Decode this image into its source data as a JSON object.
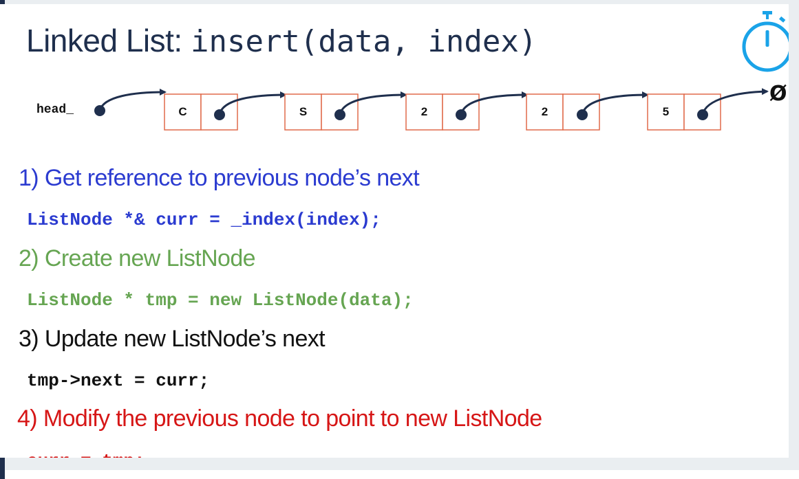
{
  "slide": {
    "title_text": "Linked List: ",
    "title_code": "insert(data, index)"
  },
  "diagram": {
    "head_label": "head_",
    "nodes": [
      "C",
      "S",
      "2",
      "2",
      "5"
    ],
    "null_symbol": "Ø",
    "node_border_color": "#e06a4a",
    "pointer_color": "#1f2f4d"
  },
  "timer": {
    "icon": "stopwatch-icon",
    "color": "#1aa3e8"
  },
  "steps": [
    {
      "label": "1) Get reference to previous node’s next",
      "code": "ListNode *& curr = _index(index);"
    },
    {
      "label": "2) Create new ListNode",
      "code": "ListNode * tmp = new ListNode(data);"
    },
    {
      "label": "3) Update new ListNode’s next",
      "code": "tmp->next = curr;"
    },
    {
      "label": "4) Modify the previous node to point to new ListNode",
      "code": "curr = tmp;"
    }
  ],
  "colors": {
    "step1": "#2b3bd0",
    "step2": "#66a552",
    "step3": "#111111",
    "step4": "#d61616"
  }
}
